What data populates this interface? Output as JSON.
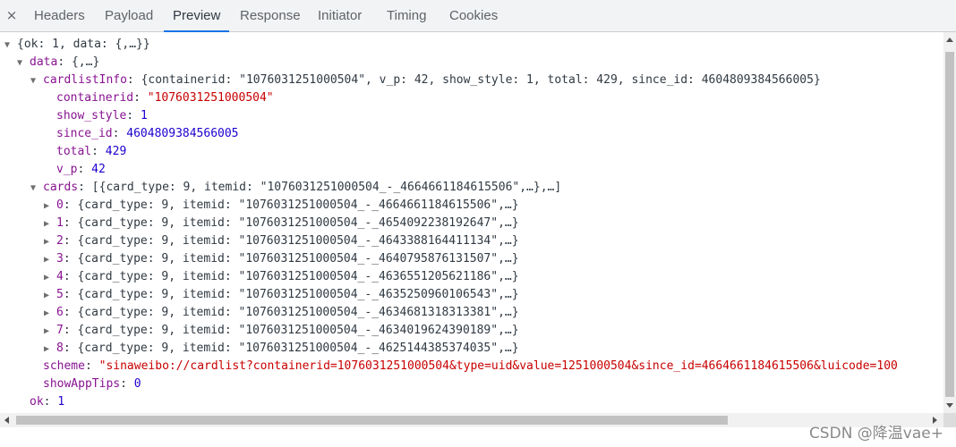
{
  "tabbar": {
    "close_label": "×",
    "tabs": [
      "Headers",
      "Payload",
      "Preview",
      "Response",
      "Initiator",
      "Timing",
      "Cookies"
    ],
    "active": "Preview"
  },
  "tree": {
    "root": "{ok: 1, data: {,…}}",
    "data_key": "data",
    "data_summary": "{,…}",
    "cardlistInfo_key": "cardlistInfo",
    "cardlistInfo_summary": "{containerid: \"1076031251000504\", v_p: 42, show_style: 1, total: 429, since_id: 4604809384566005}",
    "containerid_key": "containerid",
    "containerid_value": "\"1076031251000504\"",
    "show_style_key": "show_style",
    "show_style_value": "1",
    "since_id_key": "since_id",
    "since_id_value": "4604809384566005",
    "total_key": "total",
    "total_value": "429",
    "v_p_key": "v_p",
    "v_p_value": "42",
    "cards_key": "cards",
    "cards_summary": "[{card_type: 9, itemid: \"1076031251000504_-_4664661184615506\",…},…]",
    "cards": [
      {
        "index": "0",
        "summary": "{card_type: 9, itemid: \"1076031251000504_-_4664661184615506\",…}"
      },
      {
        "index": "1",
        "summary": "{card_type: 9, itemid: \"1076031251000504_-_4654092238192647\",…}"
      },
      {
        "index": "2",
        "summary": "{card_type: 9, itemid: \"1076031251000504_-_4643388164411134\",…}"
      },
      {
        "index": "3",
        "summary": "{card_type: 9, itemid: \"1076031251000504_-_4640795876131507\",…}"
      },
      {
        "index": "4",
        "summary": "{card_type: 9, itemid: \"1076031251000504_-_4636551205621186\",…}"
      },
      {
        "index": "5",
        "summary": "{card_type: 9, itemid: \"1076031251000504_-_4635250960106543\",…}"
      },
      {
        "index": "6",
        "summary": "{card_type: 9, itemid: \"1076031251000504_-_4634681318313381\",…}"
      },
      {
        "index": "7",
        "summary": "{card_type: 9, itemid: \"1076031251000504_-_4634019624390189\",…}"
      },
      {
        "index": "8",
        "summary": "{card_type: 9, itemid: \"1076031251000504_-_4625144385374035\",…}"
      }
    ],
    "scheme_key": "scheme",
    "scheme_value": "\"sinaweibo://cardlist?containerid=1076031251000504&type=uid&value=1251000504&since_id=4664661184615506&luicode=100",
    "showAppTips_key": "showAppTips",
    "showAppTips_value": "0",
    "ok_key": "ok",
    "ok_value": "1"
  },
  "watermark": "CSDN @降温vae+",
  "colors": {
    "key": "#881391",
    "number": "#1c00cf",
    "string": "#c80000",
    "active_tab_underline": "#1a73e8"
  }
}
